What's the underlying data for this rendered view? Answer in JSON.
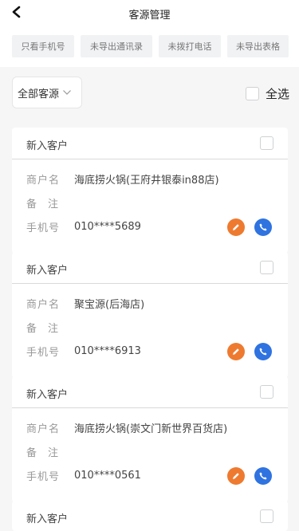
{
  "header": {
    "title": "客源管理",
    "back_icon": "chevron-left-icon"
  },
  "filters": [
    {
      "label": "只看手机号"
    },
    {
      "label": "未导出通讯录"
    },
    {
      "label": "未拨打电话"
    },
    {
      "label": "未导出表格"
    }
  ],
  "toolbar": {
    "dropdown_value": "全部客源",
    "dropdown_icon": "chevron-down-icon",
    "select_all_label": "全选"
  },
  "labels": {
    "merchant": "商户名",
    "note": "备注",
    "phone": "手机号"
  },
  "colors": {
    "edit": "#ee7a30",
    "call": "#2f73e0"
  },
  "customers": [
    {
      "status": "新入客户",
      "merchant": "海底捞火锅(王府井银泰in88店)",
      "note": "",
      "phone": "010****5689"
    },
    {
      "status": "新入客户",
      "merchant": "聚宝源(后海店)",
      "note": "",
      "phone": "010****6913"
    },
    {
      "status": "新入客户",
      "merchant": "海底捞火锅(崇文门新世界百货店)",
      "note": "",
      "phone": "010****0561"
    },
    {
      "status": "新入客户"
    }
  ]
}
